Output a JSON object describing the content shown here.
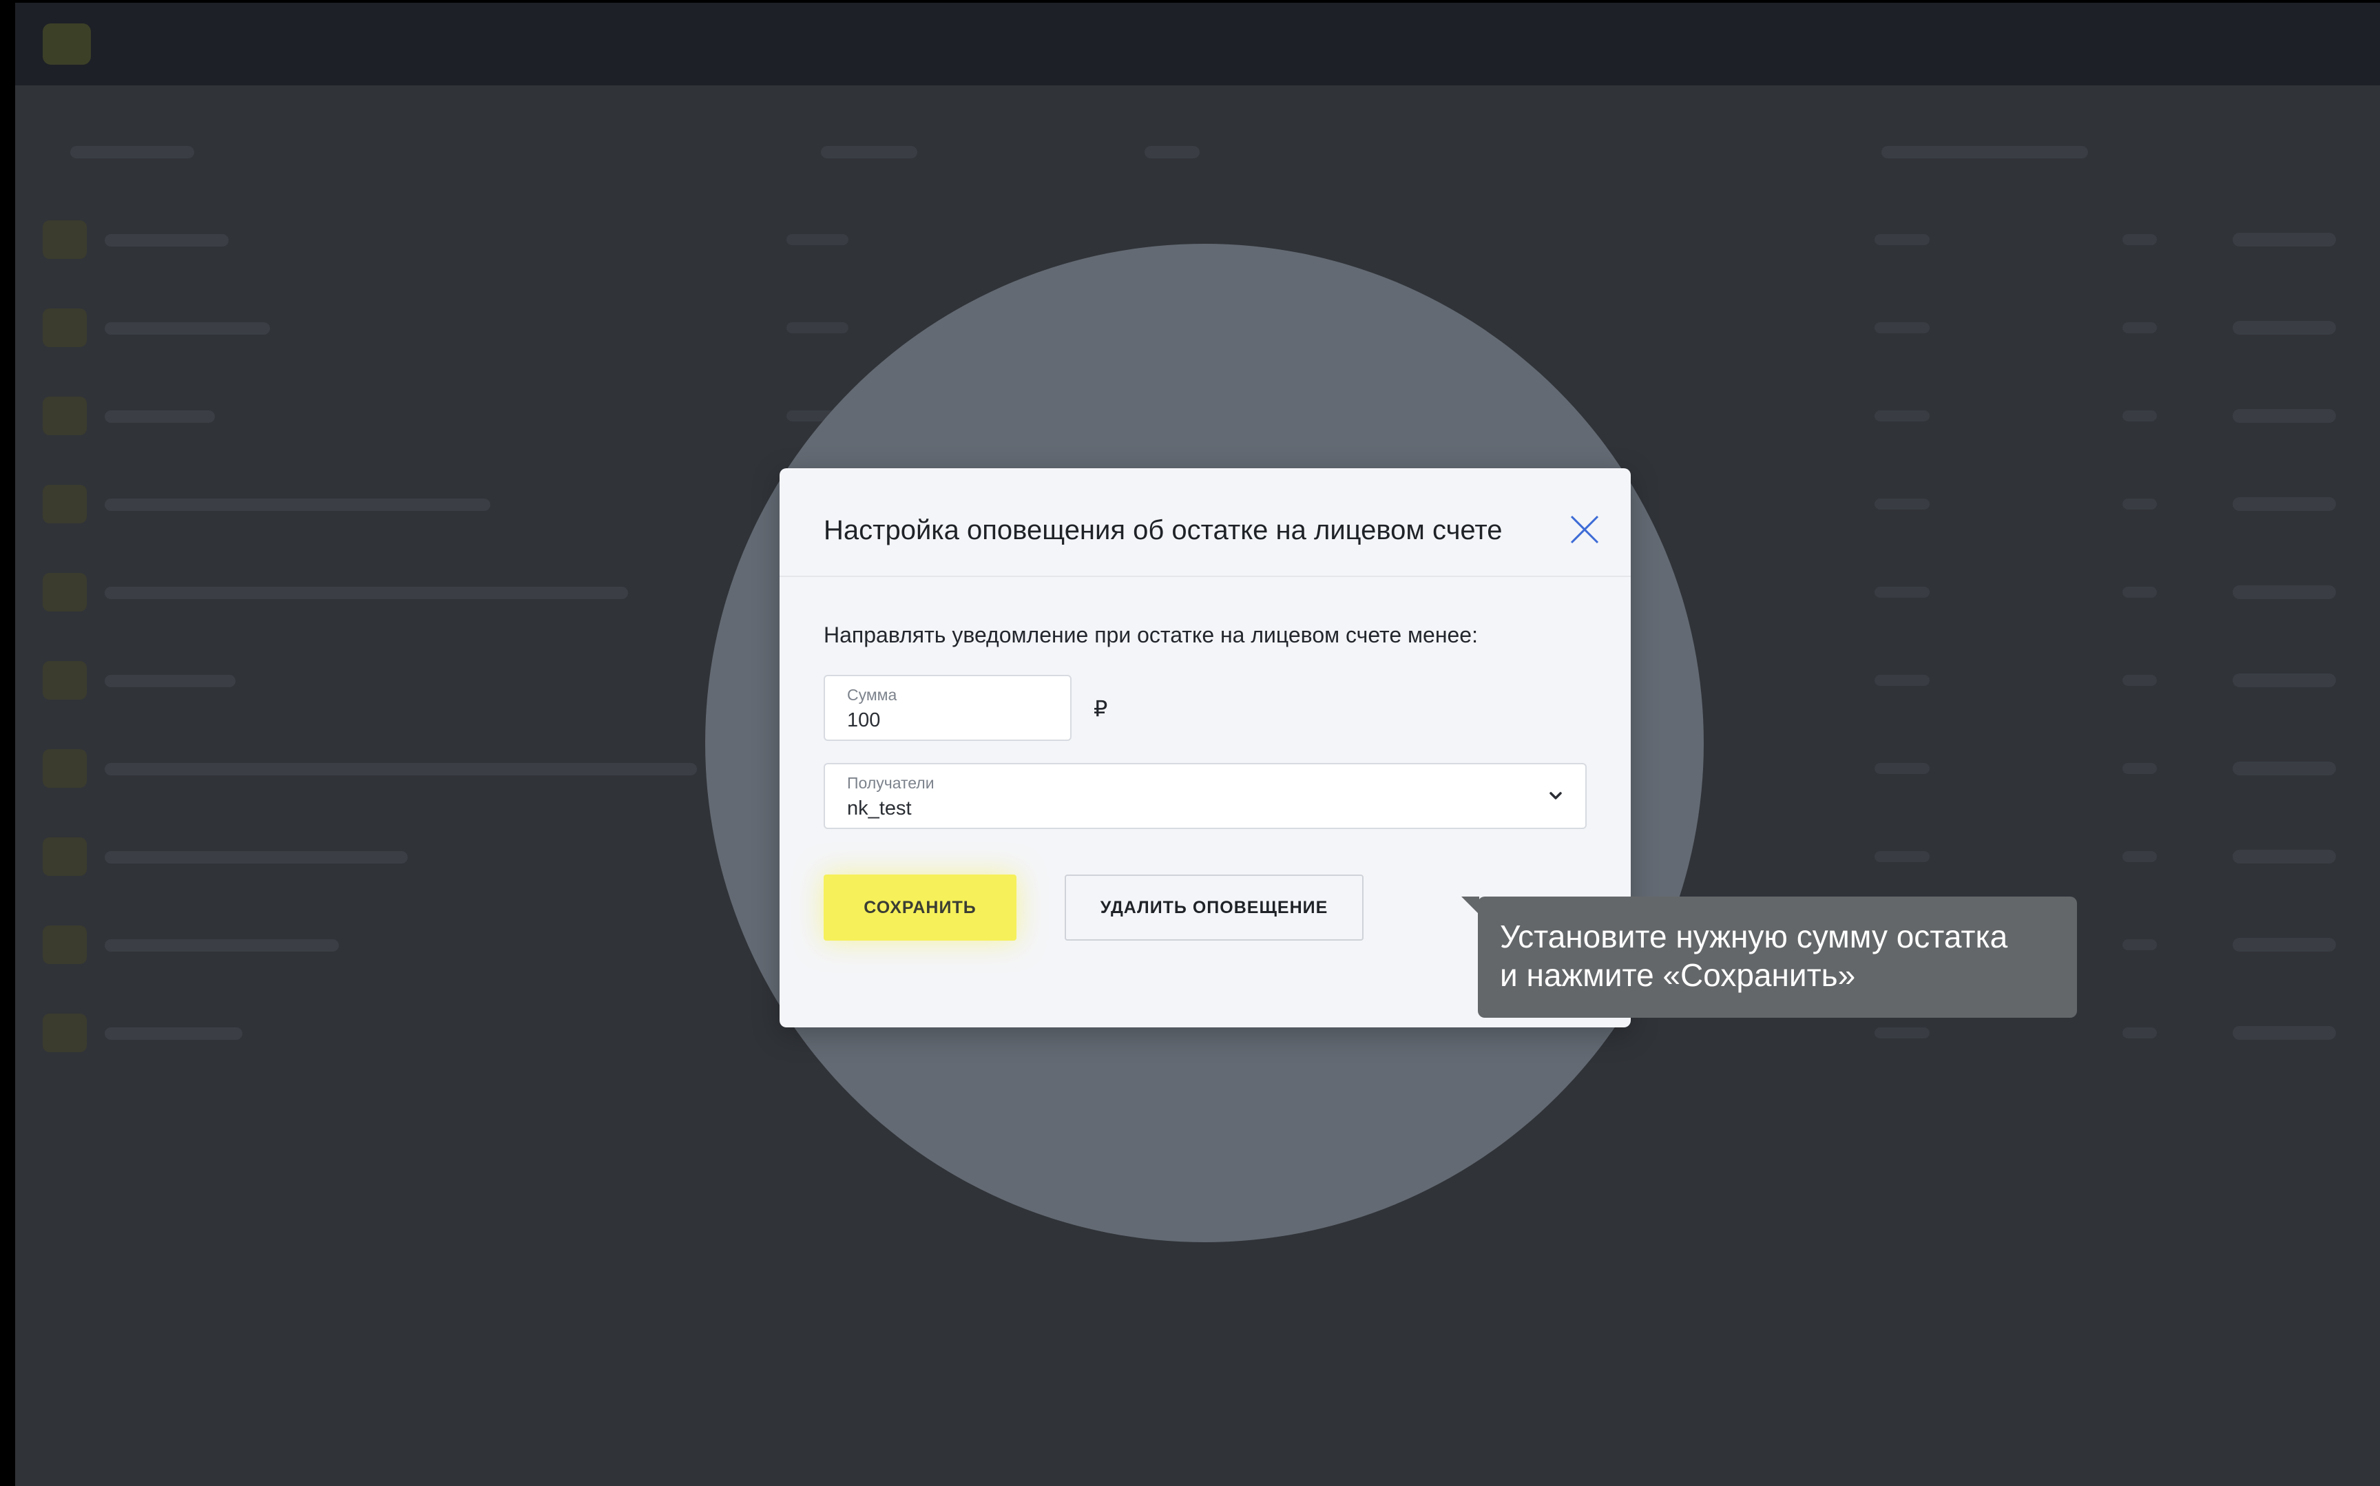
{
  "modal": {
    "title": "Настройка оповещения об остатке на лицевом счете",
    "description": "Направлять уведомление при остатке на лицевом счете менее:",
    "amount_field": {
      "label": "Сумма",
      "value": "100"
    },
    "currency_symbol": "₽",
    "recipients_field": {
      "label": "Получатели",
      "value": "nk_test"
    },
    "save_label": "СОХРАНИТЬ",
    "delete_label": "УДАЛИТЬ ОПОВЕЩЕНИЕ"
  },
  "tooltip": {
    "line1": "Установите нужную сумму остатка",
    "line2": "и нажмите «Сохранить»"
  },
  "icons": {
    "close": "close-icon",
    "chevron": "chevron-down-icon"
  },
  "colors": {
    "accent_yellow": "#f6f05a",
    "overlay": "#303338",
    "spotlight": "#636a73",
    "close_icon": "#3d6bd6",
    "tooltip_bg": "#646769"
  }
}
